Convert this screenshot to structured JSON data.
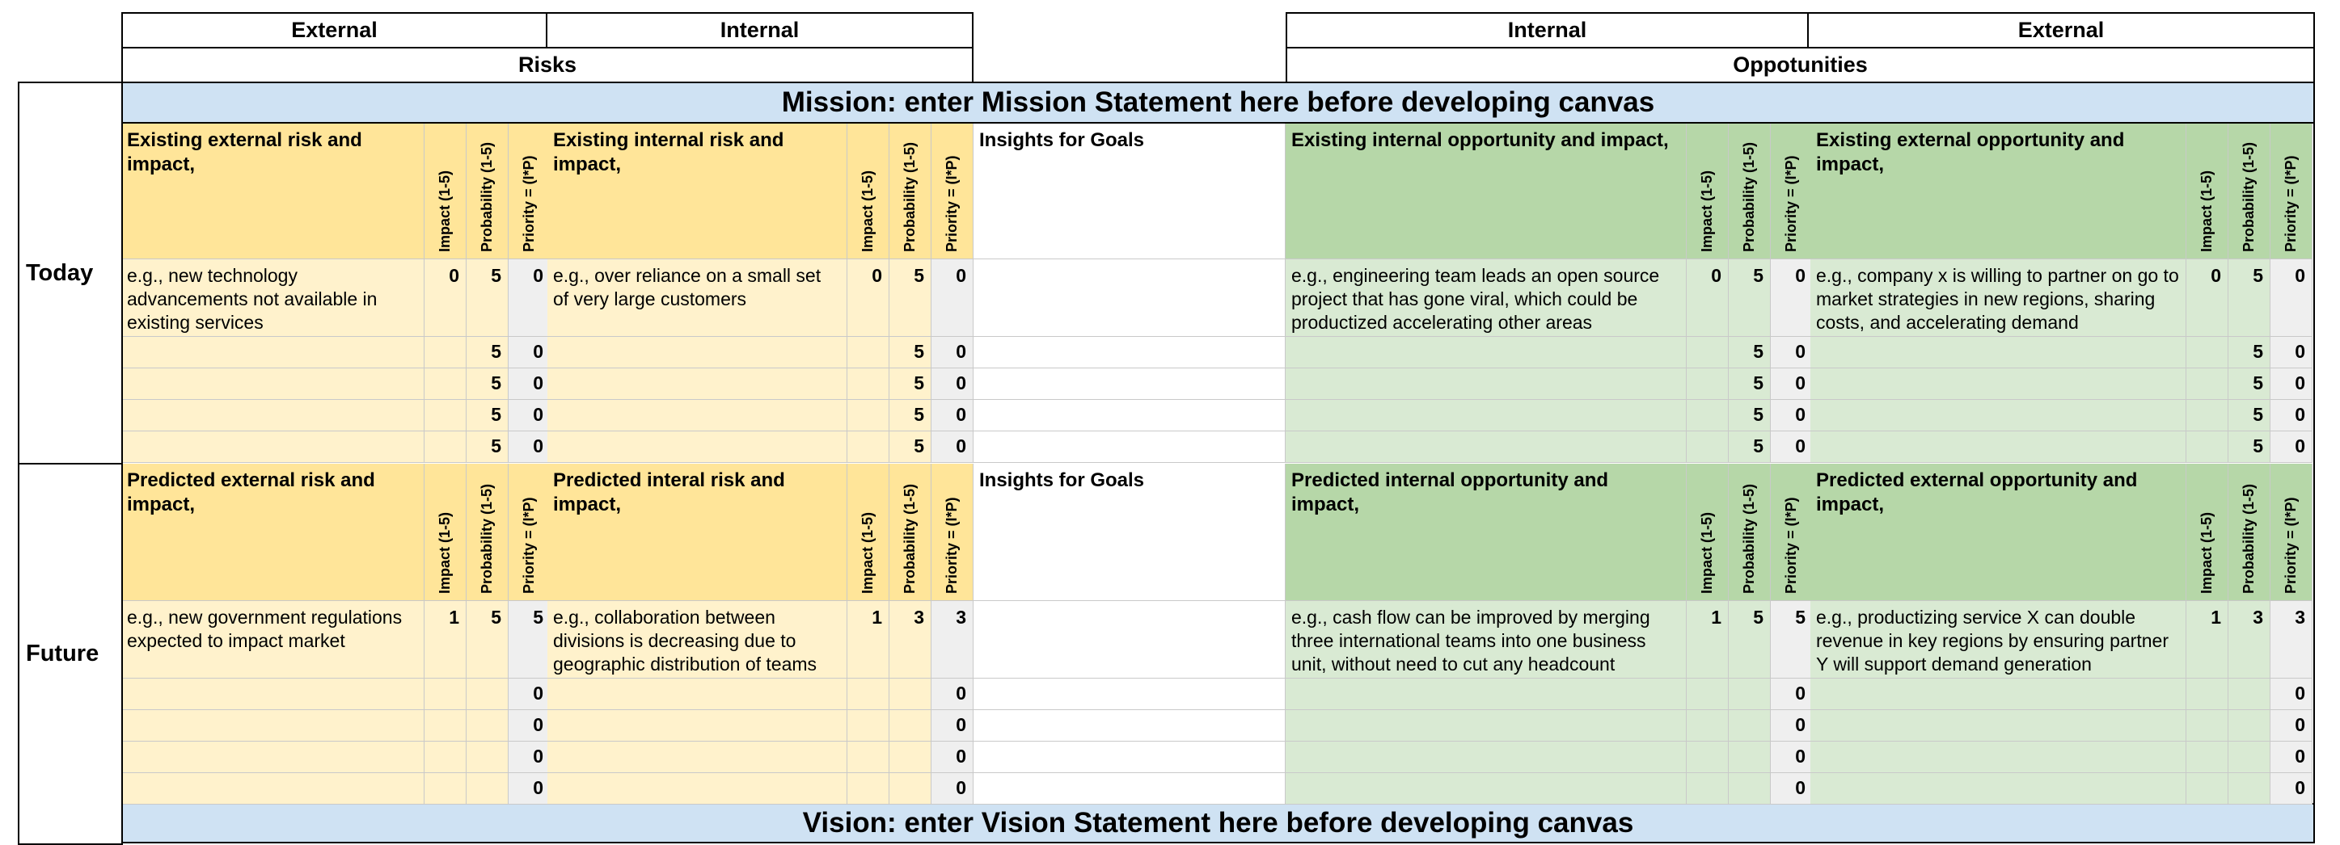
{
  "top": {
    "risks_external": "External",
    "risks_internal": "Internal",
    "risks_title": "Risks",
    "opp_internal": "Internal",
    "opp_external": "External",
    "opp_title": "Oppotunities"
  },
  "mission": "Mission: enter Mission Statement here before developing canvas",
  "vision": "Vision: enter Vision Statement here before developing canvas",
  "rows": {
    "today": "Today",
    "future": "Future"
  },
  "col_labels": {
    "impact": "Impact (1-5)",
    "probability": "Probability (1-5)",
    "priority": "Priority = (I*P)"
  },
  "insights": "Insights for Goals",
  "today": {
    "ext_risk": {
      "header": "Existing external risk and impact,",
      "example": "e.g., new technology advancements not available in existing services",
      "impact": "0",
      "probability": "5",
      "priority": "0",
      "rows": [
        [
          "",
          "5",
          "0"
        ],
        [
          "",
          "5",
          "0"
        ],
        [
          "",
          "5",
          "0"
        ],
        [
          "",
          "5",
          "0"
        ]
      ]
    },
    "int_risk": {
      "header": "Existing internal risk and impact,",
      "example": "e.g., over reliance on a small set of very large customers",
      "impact": "0",
      "probability": "5",
      "priority": "0",
      "rows": [
        [
          "",
          "5",
          "0"
        ],
        [
          "",
          "5",
          "0"
        ],
        [
          "",
          "5",
          "0"
        ],
        [
          "",
          "5",
          "0"
        ]
      ]
    },
    "int_opp": {
      "header": "Existing internal opportunity and impact,",
      "example": "e.g., engineering team leads an open source project that has gone viral, which could be productized accelerating other areas",
      "impact": "0",
      "probability": "5",
      "priority": "0",
      "rows": [
        [
          "",
          "5",
          "0"
        ],
        [
          "",
          "5",
          "0"
        ],
        [
          "",
          "5",
          "0"
        ],
        [
          "",
          "5",
          "0"
        ]
      ]
    },
    "ext_opp": {
      "header": "Existing external opportunity and impact,",
      "example": "e.g., company x is willing to partner on go to market strategies in new regions, sharing costs, and accelerating demand",
      "impact": "0",
      "probability": "5",
      "priority": "0",
      "rows": [
        [
          "",
          "5",
          "0"
        ],
        [
          "",
          "5",
          "0"
        ],
        [
          "",
          "5",
          "0"
        ],
        [
          "",
          "5",
          "0"
        ]
      ]
    }
  },
  "future": {
    "ext_risk": {
      "header": "Predicted external risk and impact,",
      "example": "e.g., new government regulations expected to impact market",
      "impact": "1",
      "probability": "5",
      "priority": "5",
      "rows": [
        [
          "",
          "",
          "0"
        ],
        [
          "",
          "",
          "0"
        ],
        [
          "",
          "",
          "0"
        ],
        [
          "",
          "",
          "0"
        ]
      ]
    },
    "int_risk": {
      "header": "Predicted interal risk and impact,",
      "example": "e.g., collaboration between divisions is decreasing due to geographic distribution of teams",
      "impact": "1",
      "probability": "3",
      "priority": "3",
      "rows": [
        [
          "",
          "",
          "0"
        ],
        [
          "",
          "",
          "0"
        ],
        [
          "",
          "",
          "0"
        ],
        [
          "",
          "",
          "0"
        ]
      ]
    },
    "int_opp": {
      "header": "Predicted internal opportunity and impact,",
      "example": "e.g., cash flow can be improved by merging three international teams into one business unit, without need to cut any  headcount",
      "impact": "1",
      "probability": "5",
      "priority": "5",
      "rows": [
        [
          "",
          "",
          "0"
        ],
        [
          "",
          "",
          "0"
        ],
        [
          "",
          "",
          "0"
        ],
        [
          "",
          "",
          "0"
        ]
      ]
    },
    "ext_opp": {
      "header": "Predicted external opportunity and impact,",
      "example": "e.g., productizing service X can double revenue in key regions by ensuring partner Y will support demand generation",
      "impact": "1",
      "probability": "3",
      "priority": "3",
      "rows": [
        [
          "",
          "",
          "0"
        ],
        [
          "",
          "",
          "0"
        ],
        [
          "",
          "",
          "0"
        ],
        [
          "",
          "",
          "0"
        ]
      ]
    }
  },
  "colors": {
    "risk_header": "#ffe599",
    "risk_body": "#fff2cc",
    "opp_header": "#b6d7a8",
    "opp_body": "#d9ead3",
    "banner": "#cfe2f3"
  }
}
